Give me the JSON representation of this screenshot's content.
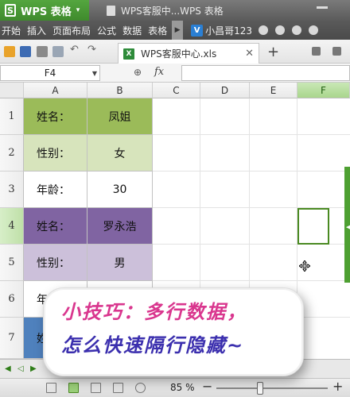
{
  "titlebar": {
    "app_name": "WPS 表格",
    "doc_title": "WPS客服中...WPS 表格"
  },
  "menu": {
    "items": [
      "开始",
      "插入",
      "页面布局",
      "公式",
      "数据",
      "表格"
    ],
    "user_name": "小昌哥123"
  },
  "toolbar": {
    "file_tab": "WPS客服中心.xls"
  },
  "formula_bar": {
    "cell_ref": "F4",
    "fx_label": "fx",
    "value": ""
  },
  "sheet": {
    "columns": [
      "A",
      "B",
      "C",
      "D",
      "E",
      "F"
    ],
    "selected_column": "F",
    "selected_row": "4",
    "rows": [
      {
        "num": "1",
        "a": "姓名：",
        "b": "凤姐"
      },
      {
        "num": "2",
        "a": "性别：",
        "b": "女"
      },
      {
        "num": "3",
        "a": "年龄：",
        "b": "30"
      },
      {
        "num": "4",
        "a": "姓名：",
        "b": "罗永浩"
      },
      {
        "num": "5",
        "a": "性别：",
        "b": "男"
      },
      {
        "num": "6",
        "a": "年",
        "b": ""
      },
      {
        "num": "7",
        "a": "姓",
        "b": ""
      }
    ],
    "row_colors": {
      "green_dark": "#9bbb59",
      "green_light": "#d7e4bc",
      "purple_dark": "#8064a2",
      "purple_light": "#ccc0da",
      "blue_dark": "#4f81bd"
    }
  },
  "statusbar": {
    "zoom": "85 %"
  },
  "tip": {
    "line1": "小技巧：多行数据，",
    "line2": "怎么快速隔行隐藏~"
  }
}
